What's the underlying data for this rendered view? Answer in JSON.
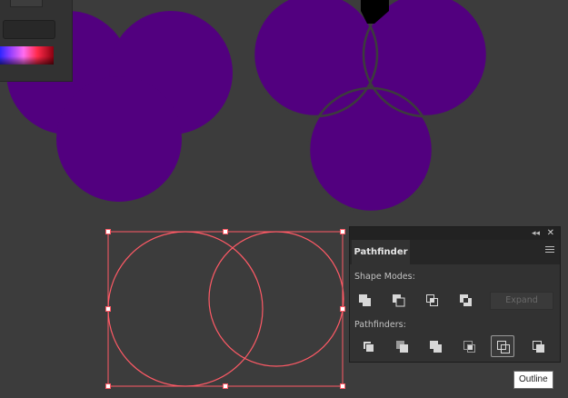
{
  "artwork": {
    "fill_color": "#52007f",
    "selection_color": "#ff5a66"
  },
  "color_panel": {
    "spectrum_icon": "color-spectrum"
  },
  "pathfinder": {
    "title": "Pathfinder",
    "shape_modes_label": "Shape Modes:",
    "pathfinders_label": "Pathfinders:",
    "expand_label": "Expand",
    "shape_mode_buttons": [
      "unite-icon",
      "minus-front-icon",
      "intersect-icon",
      "exclude-icon"
    ],
    "pathfinder_buttons": [
      "divide-icon",
      "trim-icon",
      "merge-icon",
      "crop-icon",
      "outline-icon",
      "minus-back-icon"
    ],
    "active_button": "outline-icon"
  },
  "tooltip": {
    "text": "Outline"
  }
}
